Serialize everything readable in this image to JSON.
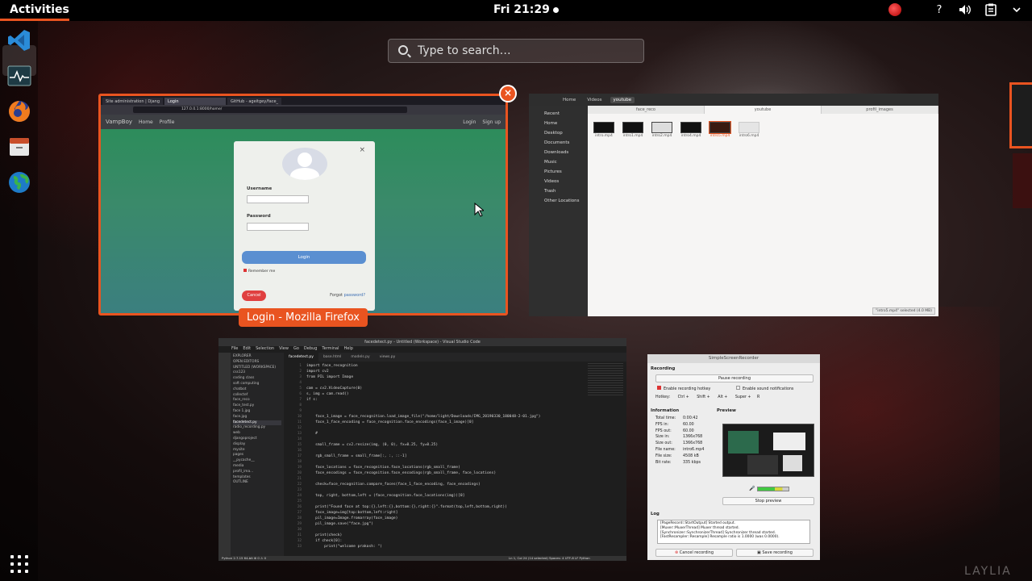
{
  "topbar": {
    "activities": "Activities",
    "clock": "Fri 21:29",
    "tray_icons": [
      "recording-indicator-icon",
      "help-icon",
      "volume-icon",
      "clipboard-icon",
      "power-menu-icon"
    ]
  },
  "dock": {
    "apps": [
      "vscode-icon",
      "system-monitor-icon",
      "firefox-icon",
      "files-icon",
      "globe-icon"
    ],
    "show_apps": "show-applications-icon"
  },
  "search": {
    "placeholder": "Type to search…"
  },
  "firefox": {
    "caption": "Login - Mozilla Firefox",
    "title": "Login - Mozilla Firefox",
    "tabs": [
      "Site administration | Djang",
      "Login",
      "GitHub - ageitgey/face_"
    ],
    "url": "127.0.0.1:8000/home/",
    "site_brand": "VampBoy",
    "nav_links": [
      "Home",
      "Profile"
    ],
    "nav_right": [
      "Login",
      "Sign up"
    ],
    "modal": {
      "close": "×",
      "username_label": "Username",
      "password_label": "Password",
      "login_button": "Login",
      "remember": "Remember me",
      "cancel": "Cancel",
      "forgot_prefix": "Forgot",
      "forgot_link": "password?"
    }
  },
  "files": {
    "breadcrumbs": [
      "Home",
      "Videos",
      "youtube"
    ],
    "sidebar": [
      "Recent",
      "Home",
      "Desktop",
      "Documents",
      "Downloads",
      "Music",
      "Pictures",
      "Videos",
      "Trash",
      "Other Locations"
    ],
    "tabs": [
      "face_reco",
      "youtube",
      "profil_images"
    ],
    "files": [
      "intro.mp4",
      "intro1.mp4",
      "intro2.mp4",
      "intro4.mp4",
      "intro5.mp4",
      "intro6.mp4"
    ],
    "status": "\"intro5.mp4\" selected (4.0 MB)"
  },
  "vscode": {
    "title": "facedetect.py - Untitled (Workspace) - Visual Studio Code",
    "menu": [
      "File",
      "Edit",
      "Selection",
      "View",
      "Go",
      "Debug",
      "Terminal",
      "Help"
    ],
    "tabs": [
      "facedetect.py",
      "base.html",
      "models.py",
      "views.py"
    ],
    "sidebar": [
      "EXPLORER",
      "OPEN EDITORS",
      "UNTITLED (WORKSPACE)",
      "css123",
      "coding class",
      "soft computing",
      "chatbot",
      "collectef",
      "face_reco",
      "face_test.py",
      "face 1.jpg",
      "face.jpg",
      "facedetect.py",
      "radio_recording.py",
      "web",
      "djangoproject",
      "display",
      "mysite",
      "pages",
      "__pycache__",
      "media",
      "profil_ima...",
      "templates",
      "OUTLINE"
    ],
    "code": [
      "import face_recognition",
      "import cv2",
      "from PIL import Image",
      "",
      "cam = cv2.VideoCapture(0)",
      "s, img = cam.read()",
      "if s:",
      "",
      "",
      "    face_1_image = face_recognition.load_image_file(\"/home/light/Downloads/IMG_20190330_180048-2-01.jpg\")",
      "    face_1_face_encoding = face_recognition.face_encodings(face_1_image)[0]",
      "",
      "    #",
      "",
      "    small_frame = cv2.resize(img, (0, 0), fx=0.25, fy=0.25)",
      "",
      "    rgb_small_frame = small_frame[:, :, ::-1]",
      "",
      "    face_locations = face_recognition.face_locations(rgb_small_frame)",
      "    face_encodings = face_recognition.face_encodings(rgb_small_frame, face_locations)",
      "",
      "    check=face_recognition.compare_faces(face_1_face_encoding, face_encodings)",
      "",
      "    top, right, bottom,left = (face_recognition.face_locations(img))[0]",
      "",
      "    print(\"Found face at top:{},left:{},bottom:{},right:{}\".format(top,left,bottom,right))",
      "    face_image=img[top:bottom,left:right]",
      "    pil_image=Image.fromarray(face_image)",
      "    pil_image.save(\"face.jpg\")",
      "",
      "    print(check)",
      "    if check[0]:",
      "        print(\"welcome prakash: \")"
    ],
    "status_left": "Python 2.7.15 64-bit ⊗ 0 ⚠ 0",
    "status_right": "Ln 1, Col 24 (14 selected)   Spaces: 4   UTF-8   LF   Python"
  },
  "ssr": {
    "title": "SimpleScreenRecorder",
    "recording_label": "Recording",
    "pause_button": "Pause recording",
    "enable_hotkey": "Enable recording hotkey",
    "enable_sound": "Enable sound notifications",
    "hotkey_label": "Hotkey:",
    "hotkey_ctrl": "Ctrl +",
    "hotkey_shift": "Shift +",
    "hotkey_alt": "Alt +",
    "hotkey_super": "Super +",
    "hotkey_key": "R",
    "information_label": "Information",
    "preview_label": "Preview",
    "info": [
      [
        "Total time:",
        "0:00:42"
      ],
      [
        "FPS in:",
        "60.00"
      ],
      [
        "FPS out:",
        "60.00"
      ],
      [
        "Size in:",
        "1366x768"
      ],
      [
        "Size out:",
        "1366x768"
      ],
      [
        "File name:",
        "intro6.mp4"
      ],
      [
        "File size:",
        "4508 kB"
      ],
      [
        "Bit rate:",
        "335 kbps"
      ]
    ],
    "stop_preview": "Stop preview",
    "log_label": "Log",
    "log_lines": [
      "[PageRecord::StartOutput] Started output.",
      "[Muxer::MuxerThread] Muxer thread started.",
      "[Synchronizer::SynchronizerThread] Synchronizer thread started.",
      "[FastResampler::Resample] Resample ratio is 1.0000 (was 0.0000)."
    ],
    "cancel_button": "Cancel recording",
    "save_button": "Save recording"
  },
  "watermark": "LAYLIA",
  "colors": {
    "accent": "#e95420",
    "topbar": "#000000"
  }
}
